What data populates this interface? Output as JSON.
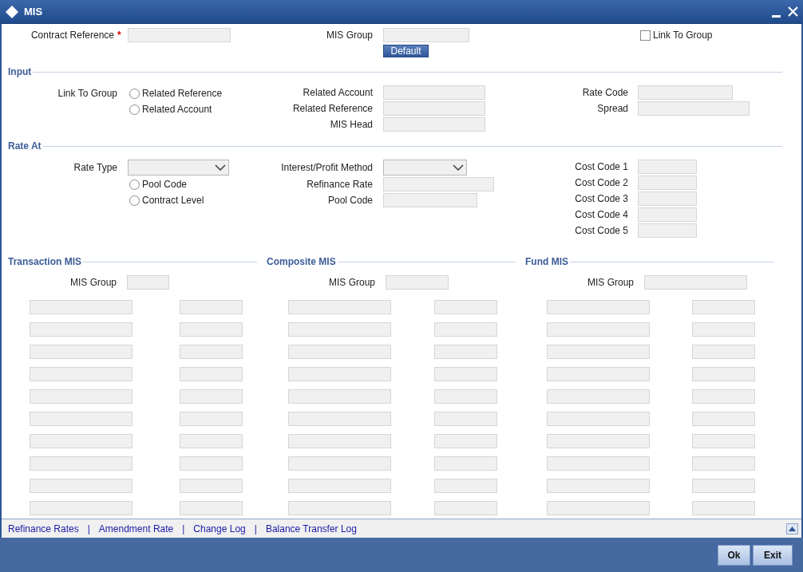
{
  "window": {
    "title": "MIS"
  },
  "header": {
    "contract_reference": {
      "label": "Contract Reference",
      "required_mark": "*"
    },
    "mis_group": {
      "label": "MIS Group"
    },
    "default_button": "Default",
    "link_to_group": {
      "label": "Link To Group",
      "checked": false
    }
  },
  "input": {
    "title": "Input",
    "link_to_group": {
      "label": "Link To Group",
      "options": [
        {
          "label": "Related Reference",
          "selected": false
        },
        {
          "label": "Related Account",
          "selected": false
        }
      ]
    },
    "fields": [
      {
        "label": "Related Account"
      },
      {
        "label": "Related Reference"
      },
      {
        "label": "MIS Head"
      }
    ],
    "rate_fields": [
      {
        "label": "Rate Code"
      },
      {
        "label": "Spread"
      }
    ]
  },
  "rate_at": {
    "title": "Rate At",
    "rate_type": {
      "label": "Rate Type"
    },
    "options": [
      {
        "label": "Pool Code",
        "selected": false
      },
      {
        "label": "Contract Level",
        "selected": false
      }
    ],
    "interest_method": {
      "label": "Interest/Profit Method"
    },
    "fields": [
      {
        "label": "Refinance Rate"
      },
      {
        "label": "Pool Code"
      }
    ],
    "cost_codes": [
      "Cost Code 1",
      "Cost Code 2",
      "Cost Code 3",
      "Cost Code 4",
      "Cost Code 5"
    ]
  },
  "mis_sections": [
    {
      "title": "Transaction MIS",
      "mis_group_label": "MIS Group"
    },
    {
      "title": "Composite MIS",
      "mis_group_label": "MIS Group"
    },
    {
      "title": "Fund MIS",
      "mis_group_label": "MIS Group"
    }
  ],
  "links": [
    {
      "kind": "link",
      "text": "Refinance Rates"
    },
    {
      "kind": "separator",
      "text": "|"
    },
    {
      "kind": "link",
      "text": "Amendment Rate"
    },
    {
      "kind": "separator",
      "text": "|"
    },
    {
      "kind": "link",
      "text": "Change Log"
    },
    {
      "kind": "separator",
      "text": "|"
    },
    {
      "kind": "link",
      "text": "Balance Transfer Log"
    }
  ],
  "buttons": [
    "Ok",
    "Exit"
  ]
}
